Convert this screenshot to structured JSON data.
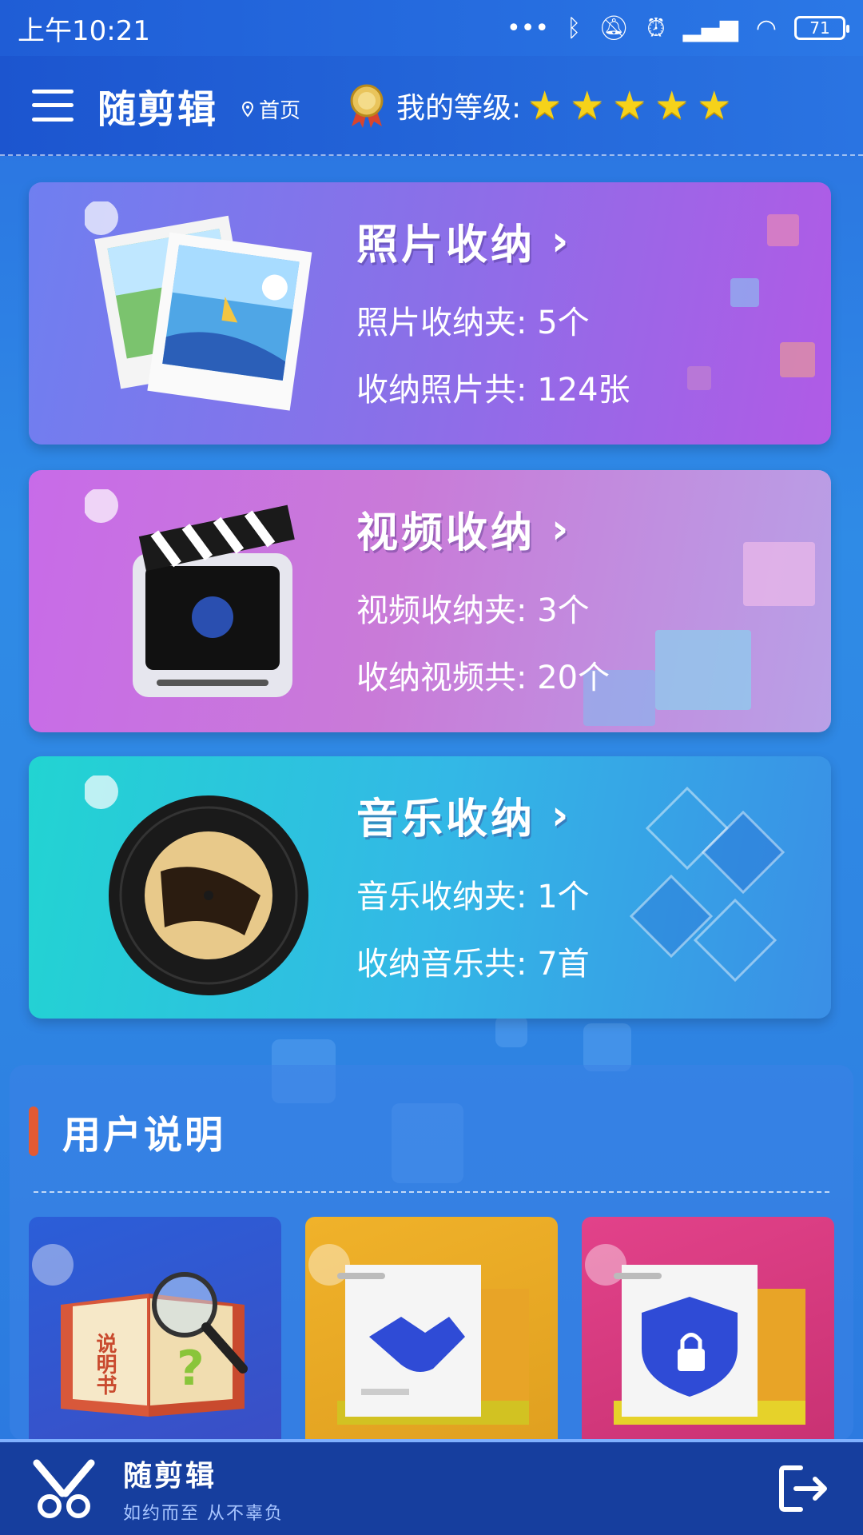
{
  "status_bar": {
    "time": "上午10:21",
    "icons": [
      "dots-icon",
      "bluetooth-icon",
      "mute-icon",
      "alarm-icon",
      "signal-icon",
      "wifi-icon"
    ],
    "battery": "71"
  },
  "header": {
    "title": "随剪辑",
    "breadcrumb": "首页",
    "level_label": "我的等级:",
    "level_stars": 5
  },
  "cards": {
    "photos": {
      "title": "照片收纳",
      "folders": "照片收纳夹: 5个",
      "total": "收纳照片共: 124张"
    },
    "videos": {
      "title": "视频收纳",
      "folders": "视频收纳夹: 3个",
      "total": "收纳视频共: 20个"
    },
    "music": {
      "title": "音乐收纳",
      "folders": "音乐收纳夹: 1个",
      "total": "收纳音乐共: 7首"
    }
  },
  "guide": {
    "title": "用户说明",
    "manual_book_text": "说明书"
  },
  "bottom_bar": {
    "brand": "随剪辑",
    "slogan": "如约而至 从不辜负"
  },
  "colors": {
    "accent": "#e25a33",
    "star": "#f6d21a",
    "bottom_bar": "#163e9e"
  }
}
